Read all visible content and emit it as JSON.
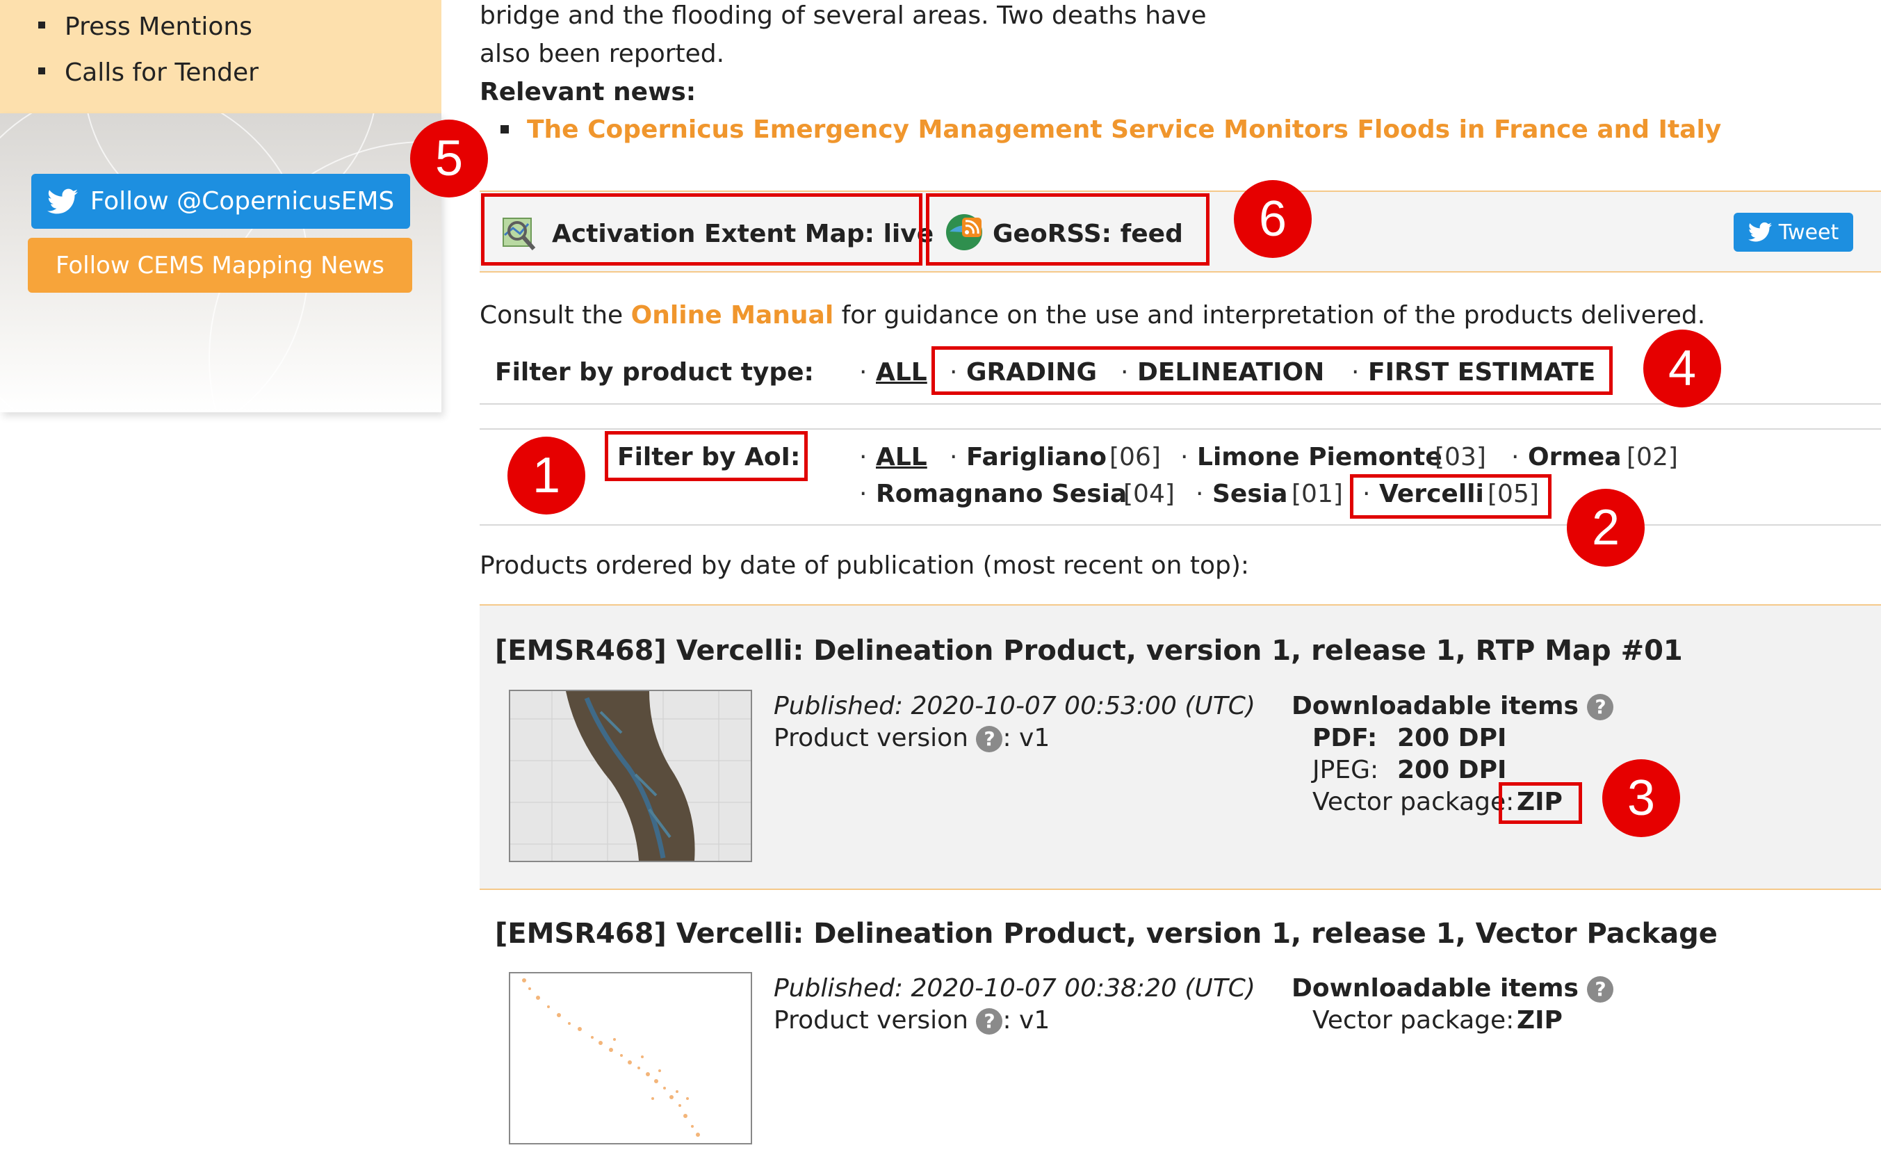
{
  "sidebar": {
    "menu": [
      "Press Mentions",
      "Calls for Tender"
    ],
    "follow_twitter": "Follow @CopernicusEMS",
    "follow_cems": "Follow CEMS Mapping News"
  },
  "intro": {
    "line1": "bridge and the flooding of several areas. Two deaths have",
    "line2": "also been reported.",
    "relevant_label": "Relevant news:",
    "news_link": "The Copernicus Emergency Management Service Monitors Floods in France and Italy"
  },
  "toolbar": {
    "activation_map": "Activation Extent Map: live",
    "georss": "GeoRSS: feed",
    "tweet": "Tweet"
  },
  "manual": {
    "before": "Consult the",
    "link": "Online Manual",
    "after": "for guidance on the use and interpretation of the products delivered."
  },
  "filter_type": {
    "label": "Filter by product type:",
    "all": "ALL",
    "options": [
      "GRADING",
      "DELINEATION",
      "FIRST ESTIMATE"
    ]
  },
  "filter_aoi": {
    "label": "Filter by AoI:",
    "all": "ALL",
    "items": [
      {
        "name": "Farigliano",
        "count": "[06]"
      },
      {
        "name": "Limone Piemonte",
        "count": "[03]"
      },
      {
        "name": "Ormea",
        "count": "[02]"
      },
      {
        "name": "Romagnano Sesia",
        "count": "[04]"
      },
      {
        "name": "Sesia",
        "count": "[01]"
      },
      {
        "name": "Vercelli",
        "count": "[05]"
      }
    ]
  },
  "products_heading": "Products ordered by date of publication (most recent on top):",
  "products": [
    {
      "title": "[EMSR468] Vercelli: Delineation Product, version 1, release 1, RTP Map #01",
      "published": "Published: 2020-10-07 00:53:00 (UTC)",
      "version_label": "Product version",
      "version_value": ": v1",
      "downloads_label": "Downloadable items",
      "pdf_label": "PDF:",
      "pdf_link": "200 DPI",
      "jpeg_label": "JPEG:",
      "jpeg_link": "200 DPI",
      "vector_label": "Vector package:",
      "vector_link": "ZIP"
    },
    {
      "title": "[EMSR468] Vercelli: Delineation Product, version 1, release 1, Vector Package",
      "published": "Published: 2020-10-07 00:38:20 (UTC)",
      "version_label": "Product version",
      "version_value": ": v1",
      "downloads_label": "Downloadable items",
      "vector_label": "Vector package:",
      "vector_link": "ZIP"
    }
  ],
  "help_glyph": "?",
  "separator": "·",
  "annotations": [
    "1",
    "2",
    "3",
    "4",
    "5",
    "6"
  ],
  "colors": {
    "link": "#f0962d",
    "annotation": "#e60000",
    "twitter": "#1d8fe0",
    "cems": "#f7a43a"
  }
}
